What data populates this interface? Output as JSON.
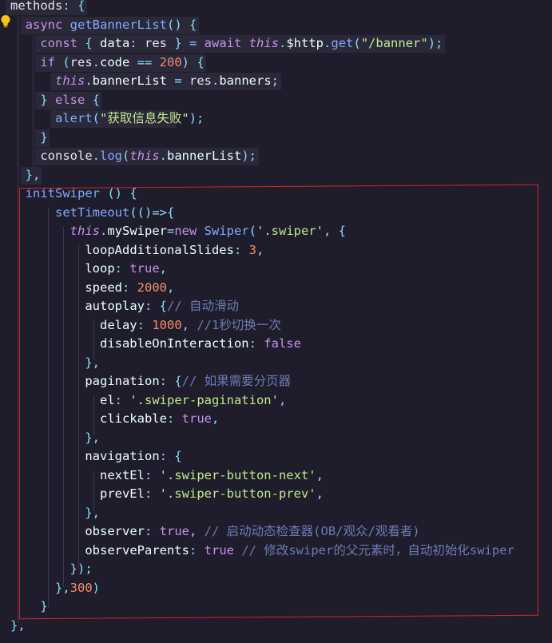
{
  "editor": {
    "lines": [
      [
        [
          "methods",
          "tok-plain"
        ],
        [
          ": {",
          "tok-op"
        ]
      ],
      [
        [
          "  ",
          "tok-plain"
        ],
        [
          "async ",
          "tok-keyword"
        ],
        [
          "getBannerList",
          "tok-fn"
        ],
        [
          "() {",
          "tok-op"
        ]
      ],
      [
        [
          "    ",
          "tok-plain"
        ],
        [
          "const ",
          "tok-keyword"
        ],
        [
          "{ ",
          "tok-op"
        ],
        [
          "data",
          "tok-prop"
        ],
        [
          ": ",
          "tok-op"
        ],
        [
          "res",
          "tok-plain"
        ],
        [
          " } = ",
          "tok-op"
        ],
        [
          "await ",
          "tok-keyword"
        ],
        [
          "this",
          "tok-this"
        ],
        [
          ".",
          "tok-op"
        ],
        [
          "$http",
          "tok-prop"
        ],
        [
          ".",
          "tok-op"
        ],
        [
          "get",
          "tok-fn"
        ],
        [
          "(",
          "tok-op"
        ],
        [
          "\"/banner\"",
          "tok-string"
        ],
        [
          ");",
          "tok-op"
        ]
      ],
      [
        [
          "    ",
          "tok-plain"
        ],
        [
          "if ",
          "tok-keyword"
        ],
        [
          "(",
          "tok-op"
        ],
        [
          "res",
          "tok-plain"
        ],
        [
          ".",
          "tok-op"
        ],
        [
          "code",
          "tok-prop"
        ],
        [
          " == ",
          "tok-op"
        ],
        [
          "200",
          "tok-number"
        ],
        [
          ") {",
          "tok-op"
        ]
      ],
      [
        [
          "      ",
          "tok-plain"
        ],
        [
          "this",
          "tok-this"
        ],
        [
          ".",
          "tok-op"
        ],
        [
          "bannerList",
          "tok-prop"
        ],
        [
          " = ",
          "tok-op"
        ],
        [
          "res",
          "tok-plain"
        ],
        [
          ".",
          "tok-op"
        ],
        [
          "banners",
          "tok-prop"
        ],
        [
          ";",
          "tok-op"
        ]
      ],
      [
        [
          "    ",
          "tok-plain"
        ],
        [
          "} ",
          "tok-op"
        ],
        [
          "else ",
          "tok-keyword"
        ],
        [
          "{",
          "tok-op"
        ]
      ],
      [
        [
          "      ",
          "tok-plain"
        ],
        [
          "alert",
          "tok-fn"
        ],
        [
          "(",
          "tok-op"
        ],
        [
          "\"获取信息失败\"",
          "tok-string"
        ],
        [
          ");",
          "tok-op"
        ]
      ],
      [
        [
          "    ",
          "tok-plain"
        ],
        [
          "}",
          "tok-op"
        ]
      ],
      [
        [
          "    ",
          "tok-plain"
        ],
        [
          "console",
          "tok-plain"
        ],
        [
          ".",
          "tok-op"
        ],
        [
          "log",
          "tok-fn"
        ],
        [
          "(",
          "tok-op"
        ],
        [
          "this",
          "tok-this"
        ],
        [
          ".",
          "tok-op"
        ],
        [
          "bannerList",
          "tok-prop"
        ],
        [
          ");",
          "tok-op"
        ]
      ],
      [
        [
          "  ",
          "tok-plain"
        ],
        [
          "},",
          "tok-op"
        ]
      ],
      [
        [
          "  ",
          "tok-plain"
        ],
        [
          "initSwiper ",
          "tok-fn"
        ],
        [
          "() {",
          "tok-op"
        ]
      ],
      [
        [
          "      ",
          "tok-plain"
        ],
        [
          "setTimeout",
          "tok-fn"
        ],
        [
          "(()=>{",
          "tok-op"
        ]
      ],
      [
        [
          "        ",
          "tok-plain"
        ],
        [
          "this",
          "tok-this"
        ],
        [
          ".",
          "tok-op"
        ],
        [
          "mySwiper",
          "tok-prop"
        ],
        [
          "=",
          "tok-op"
        ],
        [
          "new ",
          "tok-keyword"
        ],
        [
          "Swiper",
          "tok-class"
        ],
        [
          "(",
          "tok-op"
        ],
        [
          "'.swiper'",
          "tok-string"
        ],
        [
          ", {",
          "tok-op"
        ]
      ],
      [
        [
          "          ",
          "tok-plain"
        ],
        [
          "loopAdditionalSlides",
          "tok-prop"
        ],
        [
          ": ",
          "tok-op"
        ],
        [
          "3",
          "tok-number"
        ],
        [
          ",",
          "tok-op"
        ]
      ],
      [
        [
          "          ",
          "tok-plain"
        ],
        [
          "loop",
          "tok-prop"
        ],
        [
          ": ",
          "tok-op"
        ],
        [
          "true",
          "tok-bool"
        ],
        [
          ",",
          "tok-op"
        ]
      ],
      [
        [
          "          ",
          "tok-plain"
        ],
        [
          "speed",
          "tok-prop"
        ],
        [
          ": ",
          "tok-op"
        ],
        [
          "2000",
          "tok-number"
        ],
        [
          ",",
          "tok-op"
        ]
      ],
      [
        [
          "          ",
          "tok-plain"
        ],
        [
          "autoplay",
          "tok-prop"
        ],
        [
          ": {",
          "tok-op"
        ],
        [
          "// 自动滑动",
          "tok-comment"
        ]
      ],
      [
        [
          "            ",
          "tok-plain"
        ],
        [
          "delay",
          "tok-prop"
        ],
        [
          ": ",
          "tok-op"
        ],
        [
          "1000",
          "tok-number"
        ],
        [
          ", ",
          "tok-op"
        ],
        [
          "//1秒切换一次",
          "tok-comment"
        ]
      ],
      [
        [
          "            ",
          "tok-plain"
        ],
        [
          "disableOnInteraction",
          "tok-prop"
        ],
        [
          ": ",
          "tok-op"
        ],
        [
          "false",
          "tok-bool"
        ]
      ],
      [
        [
          "          ",
          "tok-plain"
        ],
        [
          "},",
          "tok-op"
        ]
      ],
      [
        [
          "          ",
          "tok-plain"
        ],
        [
          "pagination",
          "tok-prop"
        ],
        [
          ": {",
          "tok-op"
        ],
        [
          "// 如果需要分页器",
          "tok-comment"
        ]
      ],
      [
        [
          "            ",
          "tok-plain"
        ],
        [
          "el",
          "tok-prop"
        ],
        [
          ": ",
          "tok-op"
        ],
        [
          "'.swiper-pagination'",
          "tok-string"
        ],
        [
          ",",
          "tok-op"
        ]
      ],
      [
        [
          "            ",
          "tok-plain"
        ],
        [
          "clickable",
          "tok-prop"
        ],
        [
          ": ",
          "tok-op"
        ],
        [
          "true",
          "tok-bool"
        ],
        [
          ",",
          "tok-op"
        ]
      ],
      [
        [
          "          ",
          "tok-plain"
        ],
        [
          "},",
          "tok-op"
        ]
      ],
      [
        [
          "          ",
          "tok-plain"
        ],
        [
          "navigation",
          "tok-prop"
        ],
        [
          ": {",
          "tok-op"
        ]
      ],
      [
        [
          "            ",
          "tok-plain"
        ],
        [
          "nextEl",
          "tok-prop"
        ],
        [
          ": ",
          "tok-op"
        ],
        [
          "'.swiper-button-next'",
          "tok-string"
        ],
        [
          ",",
          "tok-op"
        ]
      ],
      [
        [
          "            ",
          "tok-plain"
        ],
        [
          "prevEl",
          "tok-prop"
        ],
        [
          ": ",
          "tok-op"
        ],
        [
          "'.swiper-button-prev'",
          "tok-string"
        ],
        [
          ",",
          "tok-op"
        ]
      ],
      [
        [
          "          ",
          "tok-plain"
        ],
        [
          "},",
          "tok-op"
        ]
      ],
      [
        [
          "          ",
          "tok-plain"
        ],
        [
          "observer",
          "tok-prop"
        ],
        [
          ": ",
          "tok-op"
        ],
        [
          "true",
          "tok-bool"
        ],
        [
          ", ",
          "tok-op"
        ],
        [
          "// 启动动态检查器(OB/观众/观看者)",
          "tok-comment"
        ]
      ],
      [
        [
          "          ",
          "tok-plain"
        ],
        [
          "observeParents",
          "tok-prop"
        ],
        [
          ": ",
          "tok-op"
        ],
        [
          "true ",
          "tok-bool"
        ],
        [
          "// 修改swiper的父元素时，自动初始化swiper",
          "tok-comment"
        ]
      ],
      [
        [
          "        ",
          "tok-plain"
        ],
        [
          "});",
          "tok-op"
        ]
      ],
      [
        [
          "      ",
          "tok-plain"
        ],
        [
          "},",
          "tok-op"
        ],
        [
          "300",
          "tok-number"
        ],
        [
          ")",
          "tok-op"
        ]
      ],
      [
        [
          "    ",
          "tok-plain"
        ],
        [
          "}",
          "tok-op"
        ]
      ],
      [
        [
          "",
          "tok-plain"
        ],
        [
          "},",
          "tok-op"
        ]
      ]
    ]
  },
  "colors": {
    "background": "#1f1d2b",
    "annotation_border": "#d42525",
    "lightbulb": "#f5c518"
  },
  "icons": {
    "gutter": "lightbulb-icon"
  }
}
